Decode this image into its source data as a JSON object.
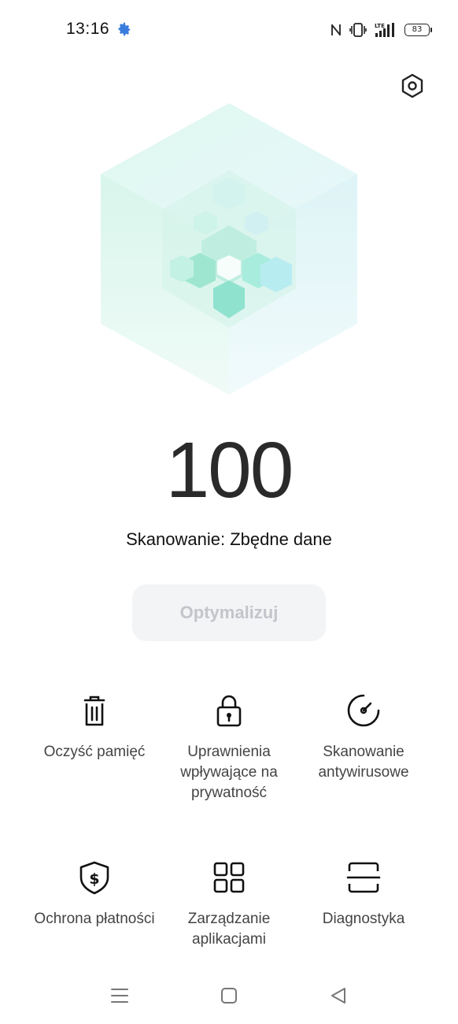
{
  "status_bar": {
    "time": "13:16",
    "battery": "83",
    "icons": [
      "settings-gear-icon",
      "nfc-icon",
      "vibrate-icon",
      "lte-signal-icon",
      "signal-bars-icon",
      "battery-icon"
    ],
    "accent_color": "#3b7ddd"
  },
  "header": {
    "settings_icon": "hexagon-settings-icon"
  },
  "score": {
    "value": "100",
    "status": "Skanowanie: Zbędne dane"
  },
  "optimize_button": {
    "label": "Optymalizuj",
    "disabled": true
  },
  "tiles": [
    {
      "label": "Oczyść pamięć",
      "icon": "trash-icon"
    },
    {
      "label": "Uprawnienia wpływające na prywatność",
      "icon": "lock-icon"
    },
    {
      "label": "Skanowanie antywirusowe",
      "icon": "gauge-icon"
    },
    {
      "label": "Ochrona płatności",
      "icon": "shield-dollar-icon"
    },
    {
      "label": "Zarządzanie aplikacjami",
      "icon": "grid-icon"
    },
    {
      "label": "Diagnostyka",
      "icon": "scan-frame-icon"
    }
  ],
  "nav_bar": {
    "icons": [
      "menu-icon",
      "home-icon",
      "back-icon"
    ]
  }
}
